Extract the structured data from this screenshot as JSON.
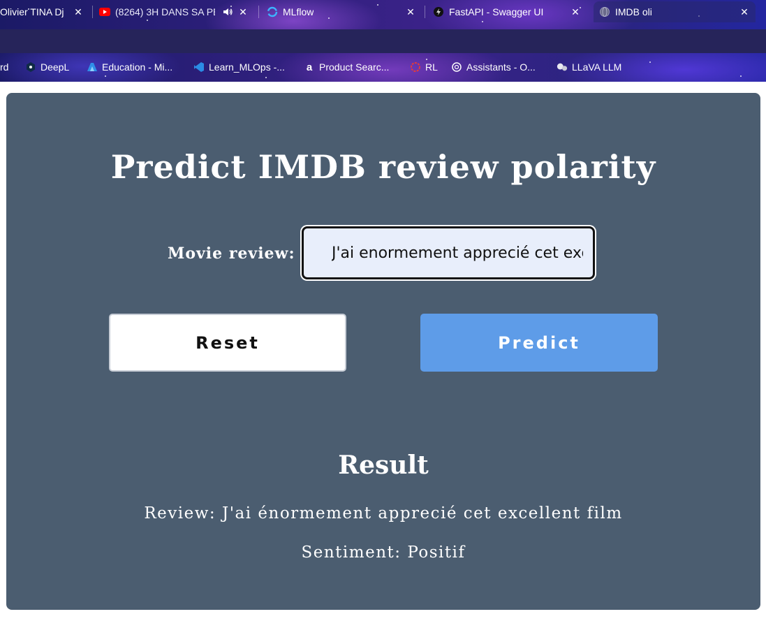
{
  "browser": {
    "tabs": [
      {
        "title": "Olivier TINA Dj",
        "icon": "user-avatar-icon"
      },
      {
        "title": "(8264) 3H DANS SA PE",
        "icon": "youtube-icon",
        "audio": true
      },
      {
        "title": "MLflow",
        "icon": "mlflow-icon"
      },
      {
        "title": "FastAPI - Swagger UI",
        "icon": "fastapi-icon"
      },
      {
        "title": "IMDB oli",
        "icon": "globe-icon",
        "active": true
      }
    ],
    "bookmarks": [
      {
        "label": "rd"
      },
      {
        "label": "DeepL",
        "icon": "deepl-icon"
      },
      {
        "label": "Education - Mi...",
        "icon": "azure-icon"
      },
      {
        "label": "Learn_MLOps -...",
        "icon": "vscode-icon"
      },
      {
        "label": "Product Searc...",
        "icon": "amazon-icon"
      },
      {
        "label": "RL",
        "icon": "ring-icon"
      },
      {
        "label": "Assistants - O...",
        "icon": "openai-icon"
      },
      {
        "label": "LLaVA LLM",
        "icon": "llava-icon"
      }
    ]
  },
  "app": {
    "heading": "Predict IMDB review polarity",
    "input_label": "Movie review:",
    "input_value": "J'ai enormement apprecié cet excellent film",
    "reset_label": "Reset",
    "predict_label": "Predict",
    "result_title": "Result",
    "review_line": "Review: J'ai énormement apprecié cet excellent film",
    "sentiment_line": "Sentiment: Positif"
  },
  "colors": {
    "page_bg": "#4b5d70",
    "input_bg": "#e8eefb",
    "predict_button": "#5e9ce8",
    "reset_button": "#ffffff"
  }
}
